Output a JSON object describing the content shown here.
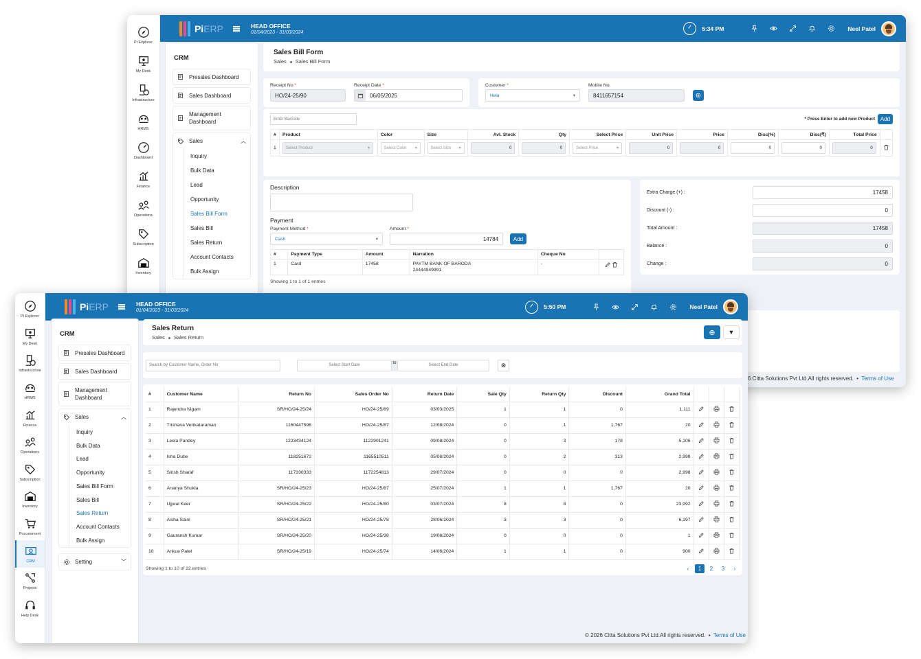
{
  "app": {
    "logo_pi": "Pi",
    "logo_erp": "ERP"
  },
  "rail_w1": [
    {
      "label": "Pi Explorer",
      "icon": "compass-icon"
    },
    {
      "label": "My Desk",
      "icon": "desk-icon"
    },
    {
      "label": "Infrastructure",
      "icon": "infrastructure-icon"
    },
    {
      "label": "HRMS",
      "icon": "hrms-icon"
    },
    {
      "label": "Dashboard",
      "icon": "dashboard-icon"
    },
    {
      "label": "Finance",
      "icon": "finance-icon"
    },
    {
      "label": "Operations",
      "icon": "operations-icon"
    },
    {
      "label": "Subscription",
      "icon": "subscription-icon"
    },
    {
      "label": "Inventory",
      "icon": "inventory-icon"
    }
  ],
  "rail_w2": [
    {
      "label": "Pi Explorer",
      "icon": "compass-icon"
    },
    {
      "label": "My Desk",
      "icon": "desk-icon"
    },
    {
      "label": "Infrastructure",
      "icon": "infrastructure-icon"
    },
    {
      "label": "HRMS",
      "icon": "hrms-icon"
    },
    {
      "label": "Finance",
      "icon": "finance-icon"
    },
    {
      "label": "Operations",
      "icon": "operations-icon"
    },
    {
      "label": "Subscription",
      "icon": "subscription-icon"
    },
    {
      "label": "Inventory",
      "icon": "inventory-icon"
    },
    {
      "label": "Procurement",
      "icon": "cart-icon"
    },
    {
      "label": "CRM",
      "icon": "crm-icon"
    },
    {
      "label": "Projects",
      "icon": "projects-icon"
    },
    {
      "label": "Help Desk",
      "icon": "headset-icon"
    }
  ],
  "w1": {
    "office": "HEAD OFFICE",
    "period": "01/04/2023 - 31/03/2024",
    "time": "5:34 PM",
    "user": "Neel Patel",
    "side": {
      "crm": "CRM",
      "presales": "Presales Dashboard",
      "sales_dash": "Sales Dashboard",
      "mgmt": "Management Dashboard",
      "sales": "Sales",
      "subs": [
        "Inquiry",
        "Bulk Data",
        "Lead",
        "Opportunity",
        "Sales Bill Form",
        "Sales Bill",
        "Sales Return",
        "Account Contacts",
        "Bulk Assign"
      ]
    },
    "page_title": "Sales Bill Form",
    "crumb1": "Sales",
    "crumb2": "Sales Bill Form",
    "receipt_no_label": "Receipt No",
    "receipt_no": "HO/24-25/90",
    "receipt_date_label": "Receipt Date",
    "receipt_date": "06/05/2025",
    "customer_label": "Customer",
    "customer": "Hela",
    "mobile_label": "Mobile No.",
    "mobile": "8411657154",
    "barcode_ph": "Enter Barcode",
    "press_enter": "* Press Enter to add new Product",
    "add": "Add",
    "product_headers": [
      "#",
      "Product",
      "Color",
      "Size",
      "Avl. Stock",
      "Qty",
      "Select Price",
      "Unit Price",
      "Price",
      "Disc(%)",
      "Disc(₹)",
      "Total Price"
    ],
    "row_no": "1",
    "select_product": "Select Product",
    "select_color": "Select Color",
    "select_size": "Select Size",
    "select_price": "Select Price",
    "zero": "0",
    "description": "Description",
    "payment": "Payment",
    "payment_method_label": "Payment Method",
    "payment_method": "Cash",
    "amount_label": "Amount",
    "amount": "14784",
    "pay_headers": [
      "#",
      "Payment Type",
      "Amount",
      "Narration",
      "Cheque No"
    ],
    "pay_row": {
      "no": "1",
      "type": "Card",
      "amount": "17458",
      "narration1": "PAYTM BANK OF BARODA",
      "narration2": "24444949991",
      "cheque": "-"
    },
    "showing": "Showing 1 to 1 of 1 entries",
    "totals": [
      {
        "label": "Extra Charge (+) :",
        "value": "17458"
      },
      {
        "label": "Discount (-) :",
        "value": "0"
      },
      {
        "label": "Total Amount :",
        "value": "17458"
      },
      {
        "label": "Balance :",
        "value": "0"
      },
      {
        "label": "Change :",
        "value": "0"
      }
    ],
    "footer": "6 Citta Solutions Pvt Ltd.All rights reserved.",
    "terms": "Terms of Use"
  },
  "w2": {
    "office": "HEAD OFFICE",
    "period": "01/04/2023 - 31/03/2024",
    "time": "5:50 PM",
    "user": "Neel Patel",
    "side": {
      "crm": "CRM",
      "presales": "Presales Dashboard",
      "sales_dash": "Sales Dashboard",
      "mgmt": "Management Dashboard",
      "sales": "Sales",
      "subs": [
        "Inquiry",
        "Bulk Data",
        "Lead",
        "Opportunity",
        "Sales Bill Form",
        "Sales Bill",
        "Sales Return",
        "Account Contacts",
        "Bulk Assign"
      ],
      "setting": "Setting"
    },
    "page_title": "Sales Return",
    "crumb1": "Sales",
    "crumb2": "Sales Return",
    "search_ph": "Search by Customer Name, Order No",
    "start_ph": "Select Start Date",
    "to": "to",
    "end_ph": "Select End Date",
    "headers": [
      "#",
      "Customer Name",
      "Return No",
      "Sales Order No",
      "Return Date",
      "Sale Qty",
      "Return Qty",
      "Discount",
      "Grand Total"
    ],
    "rows": [
      [
        "1",
        "Rajendra Nigam",
        "SR/HO/24-25/24",
        "HO/24-25/89",
        "03/03/2025",
        "1",
        "1",
        "0",
        "1,111"
      ],
      [
        "2",
        "Trishana Venkataraman",
        "1160447596",
        "HO/24-25/87",
        "12/08/2024",
        "0",
        "1",
        "1,767",
        "20"
      ],
      [
        "3",
        "Leela Pandey",
        "1223434124",
        "1122901241",
        "09/08/2024",
        "0",
        "3",
        "178",
        "5,106"
      ],
      [
        "4",
        "Isha Dube",
        "118251672",
        "1165510511",
        "05/08/2024",
        "0",
        "2",
        "313",
        "2,998"
      ],
      [
        "5",
        "Sirish Sharaf",
        "117330333",
        "1172254813",
        "29/07/2024",
        "0",
        "0",
        "0",
        "2,998"
      ],
      [
        "6",
        "Ananya Shukla",
        "SR/HO/24-25/23",
        "HO/24-25/87",
        "25/07/2024",
        "1",
        "1",
        "1,767",
        "20"
      ],
      [
        "7",
        "Ujjwal Keer",
        "SR/HO/24-25/22",
        "HO/24-25/80",
        "03/07/2024",
        "8",
        "8",
        "0",
        "23,992"
      ],
      [
        "8",
        "Aisha Saini",
        "SR/HO/24-25/21",
        "HO/24-25/78",
        "28/06/2024",
        "3",
        "3",
        "0",
        "6,197"
      ],
      [
        "9",
        "Gauransh Kumar",
        "SR/HO/24-25/20",
        "HO/24-25/38",
        "19/06/2024",
        "0",
        "0",
        "0",
        "1"
      ],
      [
        "10",
        "Ankue Patel",
        "SR/HO/24-25/19",
        "HO/24-25/74",
        "14/06/2024",
        "1",
        "1",
        "0",
        "900"
      ]
    ],
    "showing": "Showing 1 to 10 of 22 entries",
    "pages": [
      "1",
      "2",
      "3"
    ],
    "footer": "© 2026 Citta Solutions Pvt Ltd.All rights reserved.",
    "terms": "Terms of Use"
  },
  "colors": {
    "brand": "#1a73b3",
    "bg": "#eef1f5"
  }
}
